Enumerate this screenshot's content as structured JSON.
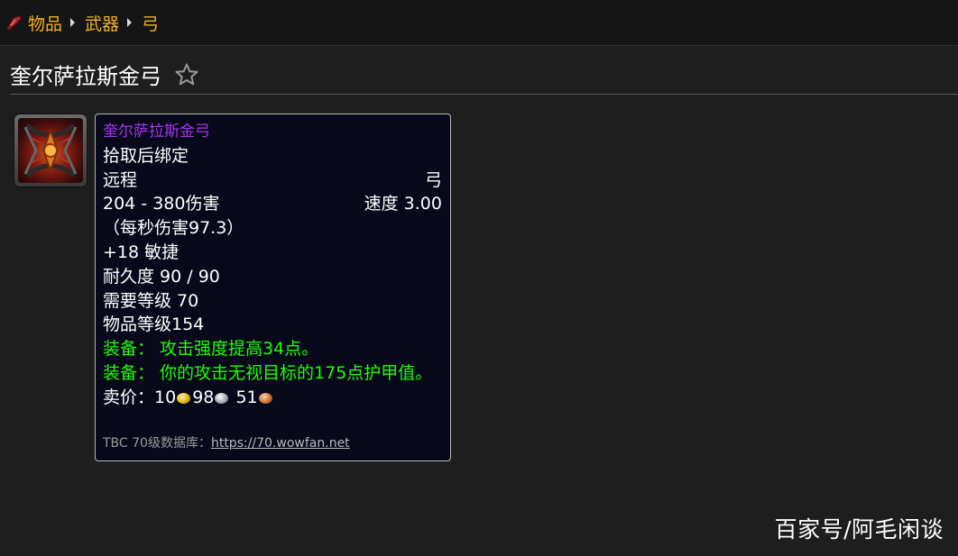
{
  "breadcrumb": {
    "items": [
      "物品",
      "武器",
      "弓"
    ]
  },
  "page": {
    "title": "奎尔萨拉斯金弓"
  },
  "item": {
    "icon": "bow-item-icon",
    "name": "奎尔萨拉斯金弓",
    "name_color": "#a335ee",
    "bind": "拾取后绑定",
    "slot": "远程",
    "type": "弓",
    "damage": "204 - 380伤害",
    "speed": "速度 3.00",
    "dps": "（每秒伤害97.3）",
    "stat": "+18 敏捷",
    "durability": "耐久度 90 / 90",
    "req_level": "需要等级 70",
    "item_level": "物品等级154",
    "equip_effects": [
      "装备：  攻击强度提高34点。",
      "装备：  你的攻击无视目标的175点护甲值。"
    ],
    "equip_color": "#1eff00",
    "sell": {
      "label": "卖价：",
      "gold": "10",
      "silver": "98",
      "copper": "51"
    },
    "footer": {
      "label": "TBC 70级数据库：",
      "link": "https://70.wowfan.net"
    }
  },
  "watermark": "百家号/阿毛闲谈",
  "colors": {
    "link": "#f2b21b",
    "background": "#1e1e1e",
    "tooltip_bg": "#07081a"
  }
}
